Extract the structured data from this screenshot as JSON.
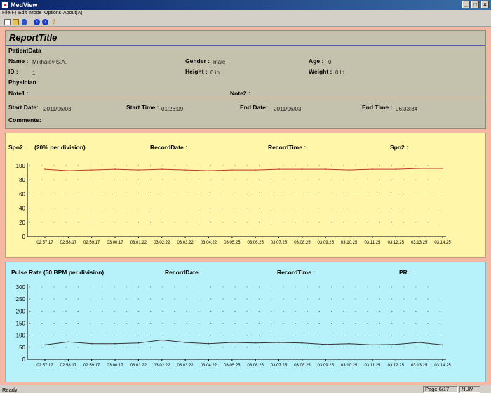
{
  "app": {
    "title": "MedView"
  },
  "menu": [
    "File(F)",
    "Edit",
    "Mode",
    "Options",
    "About(A)"
  ],
  "toolbar_icons": [
    "new-icon",
    "open-icon",
    "print-icon",
    "prev-page-icon",
    "next-page-icon",
    "help-icon"
  ],
  "report": {
    "title": "ReportTitle",
    "patient_section": "PatientData",
    "name_label": "Name :",
    "name_value": "Mikhalev S.A.",
    "gender_label": "Gender :",
    "gender_value": "male",
    "age_label": "Age :",
    "age_value": "0",
    "id_label": "ID :",
    "id_value": "1",
    "height_label": "Height :",
    "height_value": "0 in",
    "weight_label": "Weight :",
    "weight_value": "0 lb",
    "physician_label": "Physician :",
    "note1_label": "Note1 :",
    "note2_label": "Note2 :",
    "start_date_label": "Start Date:",
    "start_date_value": "2011/06/03",
    "start_time_label": "Start Time :",
    "start_time_value": "01:26:09",
    "end_date_label": "End Date:",
    "end_date_value": "2011/06/03",
    "end_time_label": "End Time :",
    "end_time_value": "06:33:34",
    "comments_label": "Comments:"
  },
  "spo2": {
    "title": "Spo2",
    "division": "(20% per division)",
    "record_date_label": "RecordDate :",
    "record_time_label": "RecordTime :",
    "value_label": "Spo2 :",
    "line_color": "#c0392b"
  },
  "pr": {
    "title": "Pulse Rate (50 BPM per division)",
    "record_date_label": "RecordDate :",
    "record_time_label": "RecordTime :",
    "value_label": "PR :",
    "line_color": "#333333"
  },
  "status": {
    "ready": "Ready",
    "page": "Page:6/17",
    "num": "NUM"
  },
  "chart_data": [
    {
      "type": "line",
      "title": "Spo2",
      "ylim": [
        0,
        100
      ],
      "yticks": [
        "0",
        "20",
        "40",
        "60",
        "80",
        "100"
      ],
      "x": [
        "02:57:17",
        "02:58:17",
        "02:59:17",
        "03:00:17",
        "03:01:22",
        "03:02:22",
        "03:03:22",
        "03:04:22",
        "03:05:25",
        "03:06:25",
        "03:07:25",
        "03:08:25",
        "03:09:25",
        "03:10:25",
        "03:11:25",
        "03:12:25",
        "03:13:25",
        "03:14:25"
      ],
      "series": [
        {
          "values": [
            95,
            93,
            94,
            95,
            94,
            95,
            94,
            93,
            94,
            94,
            95,
            95,
            95,
            94,
            95,
            95,
            96,
            96
          ]
        }
      ],
      "grid": true
    },
    {
      "type": "line",
      "title": "Pulse Rate (50 BPM per division)",
      "ylim": [
        0,
        300
      ],
      "yticks": [
        "0",
        "50",
        "100",
        "150",
        "200",
        "250",
        "300"
      ],
      "x": [
        "02:57:17",
        "02:58:17",
        "02:59:17",
        "03:00:17",
        "03:01:22",
        "03:02:22",
        "03:03:22",
        "03:04:22",
        "03:05:25",
        "03:06:25",
        "03:07:25",
        "03:08:25",
        "03:09:25",
        "03:10:25",
        "03:11:25",
        "03:12:25",
        "03:13:25",
        "03:14:25"
      ],
      "series": [
        {
          "values": [
            60,
            72,
            65,
            65,
            68,
            80,
            70,
            65,
            70,
            68,
            70,
            68,
            62,
            65,
            60,
            62,
            70,
            60
          ]
        }
      ],
      "grid": true
    }
  ]
}
